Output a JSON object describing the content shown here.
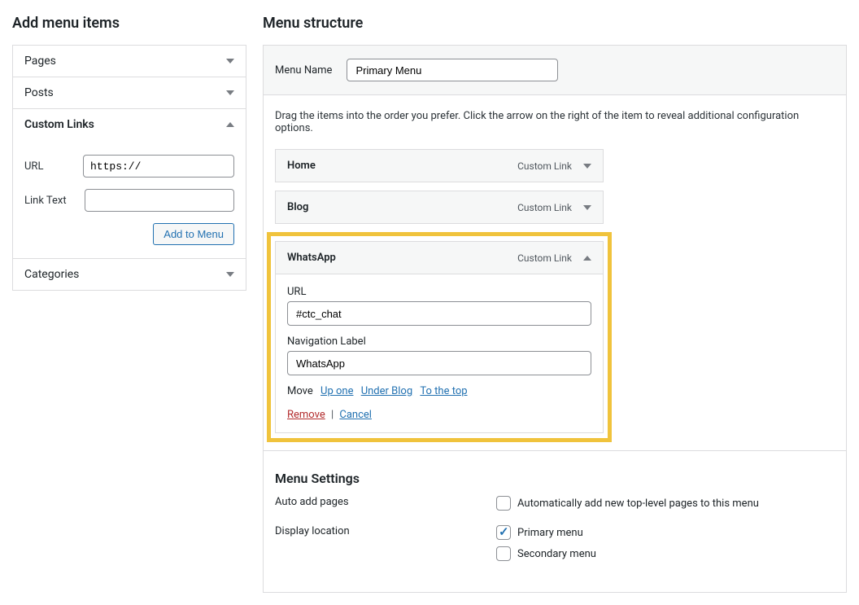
{
  "left": {
    "title": "Add menu items",
    "accordions": {
      "pages": "Pages",
      "posts": "Posts",
      "custom_links": "Custom Links",
      "categories": "Categories"
    },
    "custom_links_panel": {
      "url_label": "URL",
      "url_placeholder": "https://",
      "url_value": "https://",
      "text_label": "Link Text",
      "text_value": "",
      "add_btn": "Add to Menu"
    }
  },
  "right": {
    "title": "Menu structure",
    "menu_name_label": "Menu Name",
    "menu_name_value": "Primary Menu",
    "instructions": "Drag the items into the order you prefer. Click the arrow on the right of the item to reveal additional configuration options.",
    "items": [
      {
        "name": "Home",
        "type": "Custom Link"
      },
      {
        "name": "Blog",
        "type": "Custom Link"
      },
      {
        "name": "WhatsApp",
        "type": "Custom Link"
      }
    ],
    "expanded": {
      "url_label": "URL",
      "url_value": "#ctc_chat",
      "nav_label_label": "Navigation Label",
      "nav_label_value": "WhatsApp",
      "move_label": "Move",
      "move_links": {
        "up_one": "Up one",
        "under": "Under Blog",
        "to_top": "To the top"
      },
      "remove": "Remove",
      "cancel": "Cancel"
    },
    "settings": {
      "heading": "Menu Settings",
      "auto_add_label": "Auto add pages",
      "auto_add_option": "Automatically add new top-level pages to this menu",
      "display_label": "Display location",
      "primary_option": "Primary menu",
      "secondary_option": "Secondary menu"
    }
  }
}
